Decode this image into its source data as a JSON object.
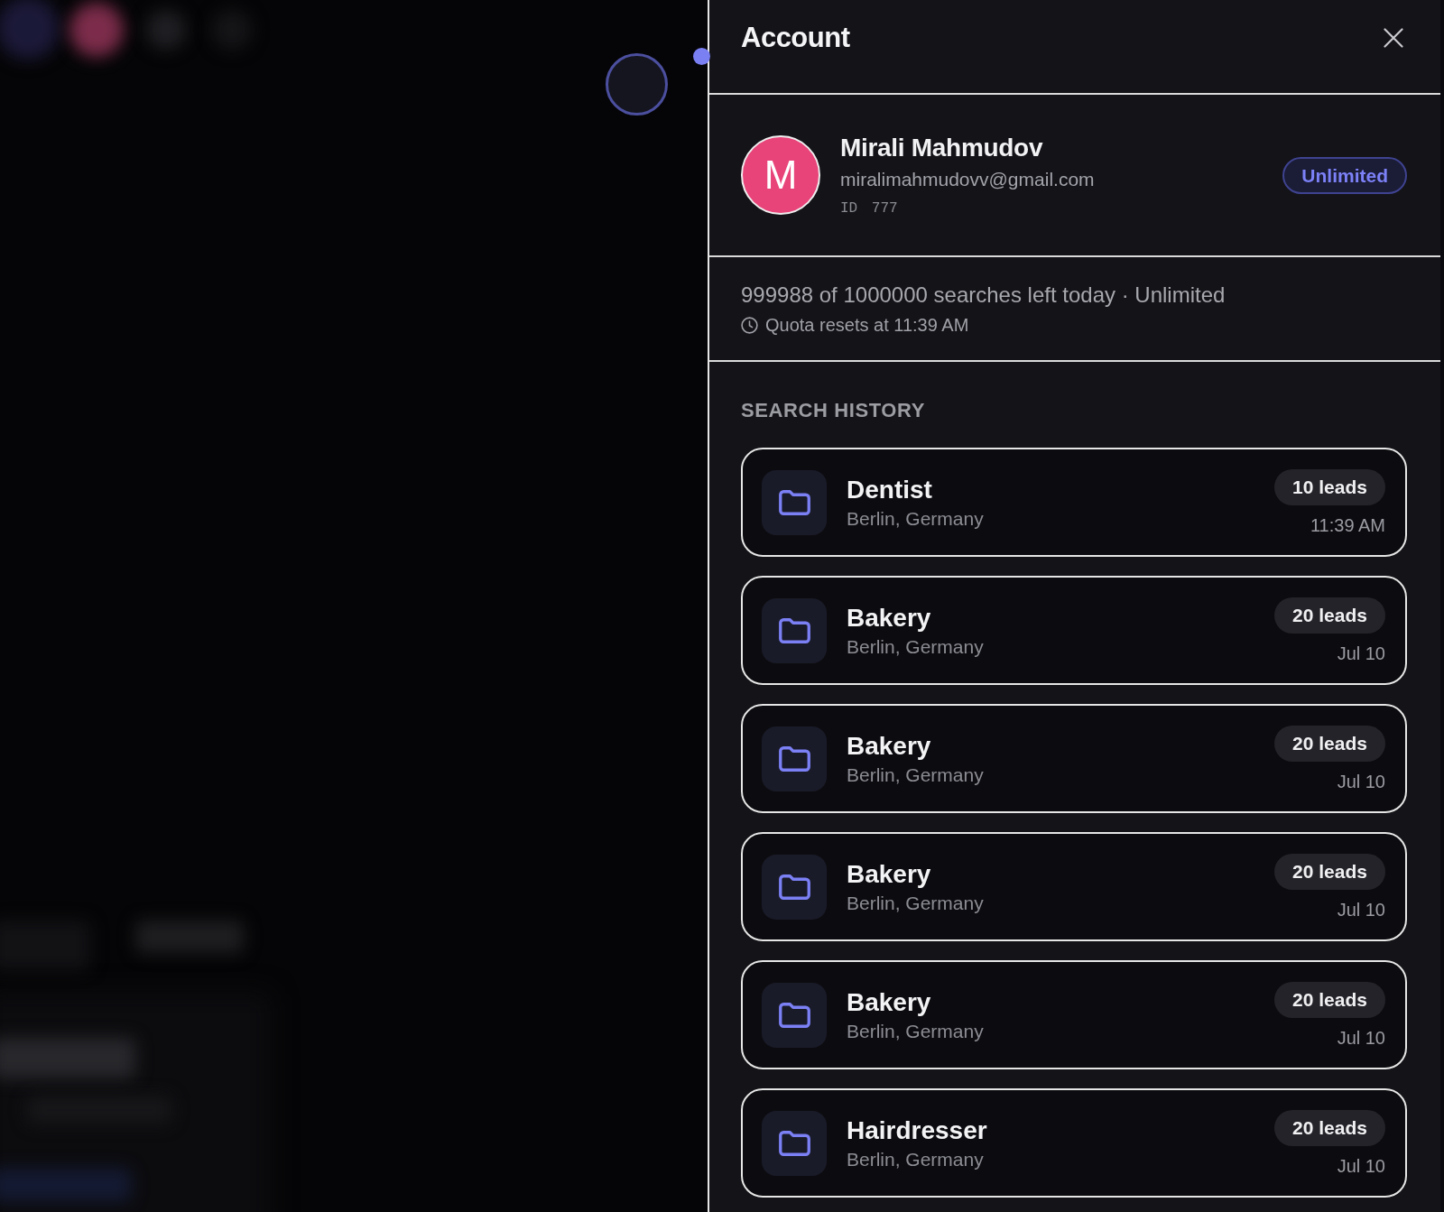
{
  "panel": {
    "title": "Account"
  },
  "profile": {
    "avatar_initial": "M",
    "name": "Mirali Mahmudov",
    "email": "miralimahmudovv@gmail.com",
    "user_id": "ID 777",
    "plan_badge": "Unlimited"
  },
  "quota": {
    "summary": "999988 of 1000000 searches left today · Unlimited",
    "reset_note": "Quota resets at 11:39 AM"
  },
  "search_history": {
    "heading": "SEARCH HISTORY",
    "items": [
      {
        "query": "Dentist",
        "location": "Berlin, Germany",
        "leads": "10 leads",
        "time": "11:39 AM"
      },
      {
        "query": "Bakery",
        "location": "Berlin, Germany",
        "leads": "20 leads",
        "time": "Jul 10"
      },
      {
        "query": "Bakery",
        "location": "Berlin, Germany",
        "leads": "20 leads",
        "time": "Jul 10"
      },
      {
        "query": "Bakery",
        "location": "Berlin, Germany",
        "leads": "20 leads",
        "time": "Jul 10"
      },
      {
        "query": "Bakery",
        "location": "Berlin, Germany",
        "leads": "20 leads",
        "time": "Jul 10"
      },
      {
        "query": "Hairdresser",
        "location": "Berlin, Germany",
        "leads": "20 leads",
        "time": "Jul 10"
      }
    ]
  }
}
